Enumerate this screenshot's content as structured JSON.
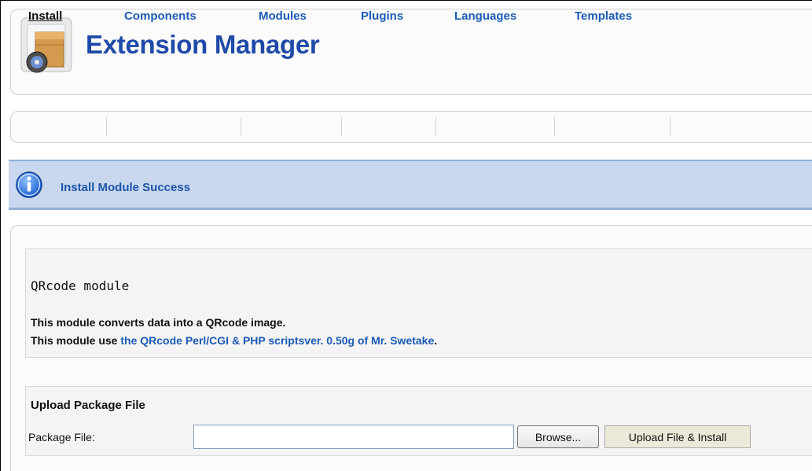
{
  "header": {
    "title": "Extension Manager",
    "logo_icon": "extension-box-disc-icon"
  },
  "tabs": [
    {
      "label": "Install",
      "active": true
    },
    {
      "label": "Components",
      "active": false
    },
    {
      "label": "Modules",
      "active": false
    },
    {
      "label": "Plugins",
      "active": false
    },
    {
      "label": "Languages",
      "active": false
    },
    {
      "label": "Templates",
      "active": false
    }
  ],
  "message": {
    "icon": "info-icon",
    "text": "Install Module Success"
  },
  "module": {
    "title": "QRcode module",
    "description_line1": "This module converts data into a QRcode image.",
    "description_line2_prefix": "This module use ",
    "description_link": "the QRcode Perl/CGI & PHP scriptsver. 0.50g of Mr. Swetake",
    "description_line2_suffix": "."
  },
  "upload": {
    "section_title": "Upload Package File",
    "field_label": "Package File:",
    "file_value": "",
    "browse_label": "Browse...",
    "submit_label": "Upload File & Install"
  },
  "colors": {
    "title_blue": "#1f4aa8",
    "link_blue": "#1c5bb6",
    "message_bg": "#c9d8ee",
    "message_border": "#8fb0dc"
  }
}
